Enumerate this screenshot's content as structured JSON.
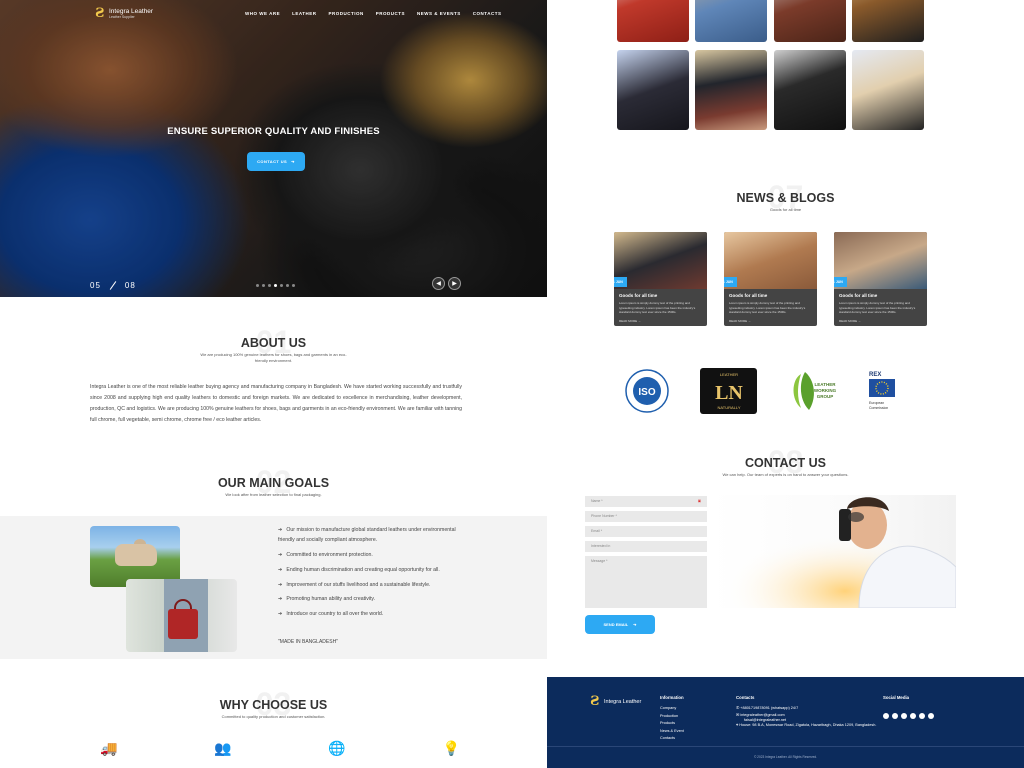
{
  "hero": {
    "brand": "Integra Leather",
    "brand_sub": "Leather Supplier",
    "nav": [
      "WHO WE ARE",
      "LEATHER",
      "PRODUCTION",
      "PRODUCTS",
      "NEWS & EVENTS",
      "CONTACTS"
    ],
    "title": "ENSURE SUPERIOR QUALITY AND FINISHES",
    "cta": "CONTACT US",
    "slide_current": "05",
    "slide_total": "08",
    "dots_total": 7,
    "dot_active": 4
  },
  "about": {
    "num": "01",
    "title": "ABOUT US",
    "subtitle": "We are producing 100% genuine leathers for shoes, bags and garments in an eco-friendly environment.",
    "body": "Integra Leather is one of the most reliable leather buying agency and manufacturing company in Bangladesh. We have started working successfully and trustfully since 2008 and supplying high end quality leathers to domestic and foreign markets. We are dedicated to excellence in merchandising, leather development, production, QC and logistics. We are producing 100% genuine leathers for shoes, bags and garments in an eco-friendly environment. We are familiar with tanning full chrome, full vegetable, semi chrome, chrome free / eco leather articles."
  },
  "goals": {
    "num": "02",
    "title": "OUR MAIN GOALS",
    "subtitle": "We look after from leather selection to final packaging.",
    "items": [
      "Our mission to manufacture global standard leathers under environmental friendly and socially compliant atmosphere.",
      "Committed to environment protection.",
      "Ending human discrimination and creating equal opportunity for all.",
      "Improvement of our stuffs livelihood and a sustainable lifestyle.",
      "Promoting human ability and creativity.",
      "Introduce our country to all over the world."
    ],
    "made_in": "\"MADE IN BANGLADESH\""
  },
  "why": {
    "num": "03",
    "title": "WHY CHOOSE US",
    "subtitle": "Committed to quality production and customer satisfaction.",
    "icons": [
      "delivery-truck-icon",
      "team-stars-icon",
      "global-network-icon",
      "idea-book-icon"
    ]
  },
  "news": {
    "num": "07",
    "title": "NEWS & BLOGS",
    "subtitle": "Goods for all time",
    "cards": [
      {
        "date": "11 JUN",
        "title": "Goods for all time",
        "text": "Lorem ipsum is simply dummy text of the printing and typesetting industry. Lorem ipsum has been the industry's standard dummy text ever since the 1500s.",
        "more": "READ MORE →"
      },
      {
        "date": "11 JUN",
        "title": "Goods for all time",
        "text": "Lorem ipsum is simply dummy text of the printing and typesetting industry. Lorem ipsum has been the industry's standard dummy text ever since the 1500s.",
        "more": "READ MORE →"
      },
      {
        "date": "11 JUN",
        "title": "Goods for all time",
        "text": "Lorem ipsum is simply dummy text of the printing and typesetting industry. Lorem ipsum has been the industry's standard dummy text ever since the 1500s.",
        "more": "READ MORE →"
      }
    ]
  },
  "certs": {
    "iso": "ISO",
    "iso_ring": "International Organization for Standardization",
    "lwg": "LEATHER WORKING GROUP",
    "ln_top": "LEATHER",
    "ln_bottom": "NATURALLY",
    "rex": "REX",
    "rex_sub": "European Commission"
  },
  "contact": {
    "num": "08",
    "title": "CONTACT US",
    "subtitle": "We can help. Our team of experts is on hand to answer your questions.",
    "fields": [
      "Name *",
      "Phone Number *",
      "Email *",
      "Interested in",
      "Message *"
    ],
    "send": "SEND EMAIL"
  },
  "footer": {
    "brand": "Integra Leather",
    "info_head": "Information",
    "info_items": [
      "Company",
      "Production",
      "Products",
      "News & Event",
      "Contacts"
    ],
    "contacts_head": "Contacts",
    "phone": "+8801719878091 (whatsapp) 24/7",
    "email": "integraleather@gmail.com",
    "email2": "faisal@integraleather.net",
    "address": "House: 98 B.A, Moneswar Road, Zigatola, Hazaribagh, Dhaka 1209, Bangladesh.",
    "social_head": "Social Media",
    "copyright": "© 2023 Integra Leather. All Rights Reserved."
  }
}
